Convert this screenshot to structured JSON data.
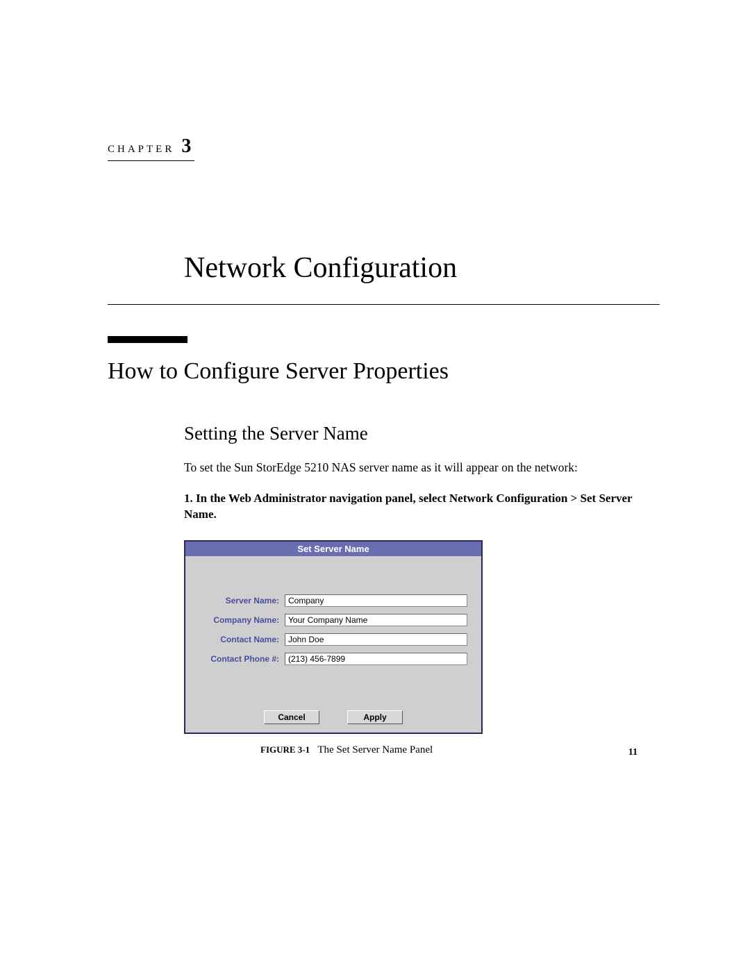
{
  "chapter": {
    "label": "CHAPTER",
    "number": "3"
  },
  "title": "Network Configuration",
  "section": "How to Configure Server Properties",
  "subsection": "Setting the Server Name",
  "body": "To set the Sun StorEdge 5210 NAS server name as it will appear on the network:",
  "step": {
    "num": "1.",
    "text": "In the Web Administrator navigation panel, select Network Configuration > Set Server Name."
  },
  "panel": {
    "title": "Set Server Name",
    "fields": {
      "server_name": {
        "label": "Server Name:",
        "value": "Company"
      },
      "company_name": {
        "label": "Company Name:",
        "value": "Your Company Name"
      },
      "contact_name": {
        "label": "Contact Name:",
        "value": "John Doe"
      },
      "contact_phone": {
        "label": "Contact Phone #:",
        "value": "(213) 456-7899"
      }
    },
    "buttons": {
      "cancel": "Cancel",
      "apply": "Apply"
    }
  },
  "figure": {
    "label": "FIGURE 3-1",
    "caption": "The Set Server Name Panel"
  },
  "page_number": "11"
}
